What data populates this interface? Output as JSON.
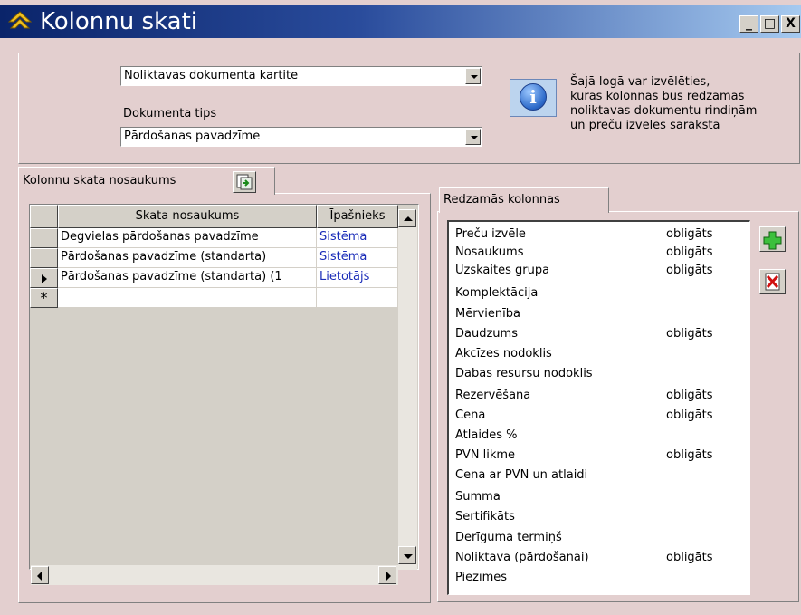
{
  "window": {
    "title": "Kolonnu skati",
    "minimize": "_",
    "maximize": "□",
    "close": "X"
  },
  "top": {
    "document_combo_value": "Noliktavas dokumenta kartite",
    "doc_type_label": "Dokumenta tips",
    "doc_type_value": "Pārdošanas pavadzīme",
    "info_lines": [
      "Šajā logā var izvēlēties,",
      "kuras kolonnas būs redzamas",
      "noliktavas dokumentu rindiņām",
      "un preču izvēles sarakstā"
    ]
  },
  "left": {
    "tab_label": "Kolonnu skata nosaukums",
    "columns": [
      "Skata nosaukums",
      "Īpašnieks"
    ],
    "rows": [
      {
        "name": "Degvielas pārdošanas pavadzīme",
        "owner": "Sistēma",
        "marker": ""
      },
      {
        "name": "Pārdošanas pavadzīme (standarta)",
        "owner": "Sistēma",
        "marker": ""
      },
      {
        "name": "Pārdošanas pavadzīme (standarta) (1",
        "owner": "Lietotājs",
        "marker": "current"
      }
    ],
    "new_row_marker": "*"
  },
  "right": {
    "tab_label": "Redzamās kolonnas",
    "items": [
      {
        "label": "Preču izvēle",
        "req": "obligāts"
      },
      {
        "label": "Nosaukums",
        "req": "obligāts"
      },
      {
        "label": "Uzskaites grupa",
        "req": "obligāts"
      },
      {
        "label": "Komplektācija",
        "req": ""
      },
      {
        "label": "Mērvienība",
        "req": ""
      },
      {
        "label": "Daudzums",
        "req": "obligāts"
      },
      {
        "label": "Akcīzes nodoklis",
        "req": ""
      },
      {
        "label": "Dabas resursu nodoklis",
        "req": ""
      },
      {
        "label": "Rezervēšana",
        "req": "obligāts"
      },
      {
        "label": "Cena",
        "req": "obligāts"
      },
      {
        "label": "Atlaides %",
        "req": ""
      },
      {
        "label": "PVN likme",
        "req": "obligāts"
      },
      {
        "label": "Cena ar PVN un atlaidi",
        "req": ""
      },
      {
        "label": "Summa",
        "req": ""
      },
      {
        "label": "Sertifikāts",
        "req": ""
      },
      {
        "label": "Derīguma termiņš",
        "req": ""
      },
      {
        "label": "Noliktava (pārdošanai)",
        "req": "obligāts"
      },
      {
        "label": "Piezīmes",
        "req": ""
      }
    ]
  },
  "icons": [
    "app-icon",
    "info-icon",
    "export-icon",
    "add-icon",
    "remove-icon"
  ]
}
